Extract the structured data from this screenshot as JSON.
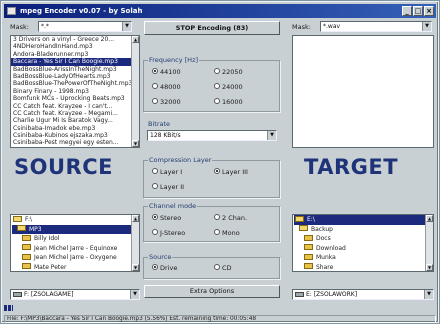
{
  "window": {
    "title": "mpeg Encoder v0.07 - by Solah",
    "minimize": "_",
    "maximize": "□",
    "close": "×"
  },
  "source": {
    "mask_label": "Mask:",
    "mask_value": "*.*",
    "files": [
      "3 Drivers on a vinyl - Greece 20...",
      "4NDHeroHandInHand.mp3",
      "Andora-Bladerunner.mp3",
      "Baccara - Yes Sir I Can Boogie.mp3",
      "BadBossBlue-ArissInTheNight.mp3",
      "BadBossBlue-LadyOfHearts.mp3",
      "BadBossBlue-ThePowerOfTheNight.mp3",
      "Binary Finary - 1998.mp3",
      "Bomfunk MCs - Uprocking Beats.mp3",
      "CC Catch feat. Krayzee - I can't...",
      "CC Catch feat. Krayzee - Megami...",
      "Charlie Ugur Mi Is Baratok Vagy...",
      "Csinibaba-Imadok ebe.mp3",
      "Csinibaba-Kubinos ejszaka.mp3",
      "Csinibaba-Pest megyei egy esten..."
    ],
    "selected_index": 3,
    "big_label": "SOURCE",
    "dirs": [
      "F:\\",
      "MP3",
      "Billy Idol",
      "Jean Michel Jarre - Equinoxe",
      "Jean Michel Jarre - Oxygene",
      "Mate Peter"
    ],
    "selected_dir": 1,
    "drive": "F: [ZSOLAGAME]"
  },
  "center": {
    "stop_button": "STOP Encoding (83)",
    "frequency": {
      "title": "Frequency [Hz]",
      "options": [
        "44100",
        "22050",
        "48000",
        "24000",
        "32000",
        "16000"
      ],
      "selected": 0
    },
    "bitrate": {
      "title": "Bitrate",
      "value": "128 KBit/s"
    },
    "compression": {
      "title": "Compression Layer",
      "options": [
        "Layer I",
        "Layer III",
        "Layer II"
      ],
      "selected": 1
    },
    "channel": {
      "title": "Channel mode",
      "options": [
        "Stereo",
        "2 Chan.",
        "J-Stereo",
        "Mono"
      ],
      "selected": 0
    },
    "source_type": {
      "title": "Source",
      "options": [
        "Drive",
        "CD"
      ],
      "selected": 0
    },
    "extra_button": "Extra Options"
  },
  "target": {
    "mask_label": "Mask:",
    "mask_value": "*.wav",
    "big_label": "TARGET",
    "dirs": [
      "E:\\",
      "Backup",
      "Docs",
      "Download",
      "Munka",
      "Share"
    ],
    "selected_dir": 0,
    "drive": "E: [ZSOLAWORK]"
  },
  "progress": {
    "fraction": 0.02
  },
  "status": {
    "text": "File: F:\\MP3\\Baccara - Yes Sir I Can Boogie.mp3 (5.56%) Est. remaining time: 00:05:48"
  },
  "colors": {
    "title_start": "#0a1f7a",
    "title_end": "#3560b8",
    "selection": "#1c2a7e",
    "big_label": "#1f3478",
    "folder": "#e6c34a"
  }
}
